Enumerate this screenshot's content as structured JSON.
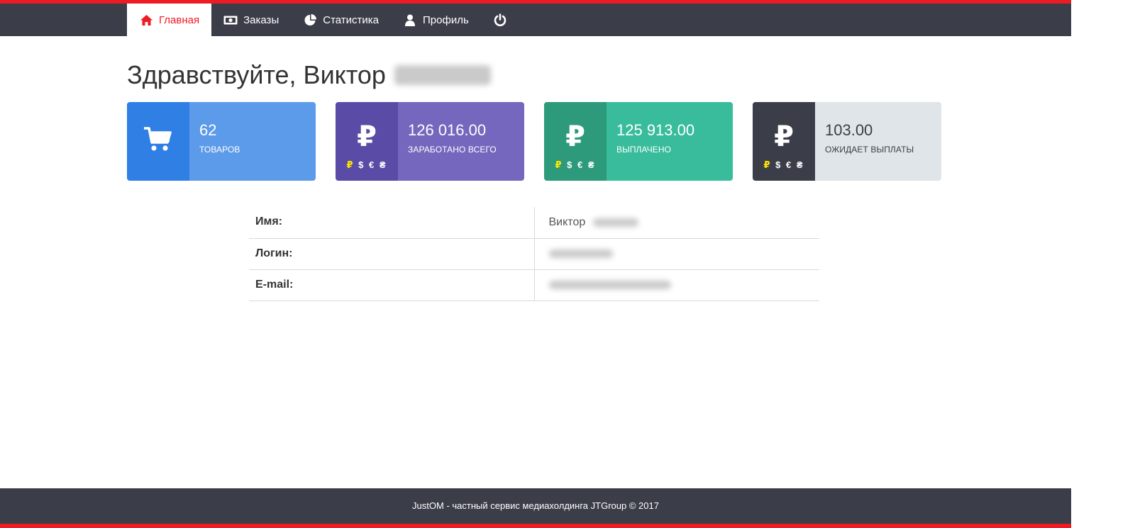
{
  "nav": {
    "items": [
      {
        "label": "Главная",
        "icon": "home-icon",
        "active": true
      },
      {
        "label": "Заказы",
        "icon": "money-icon",
        "active": false
      },
      {
        "label": "Статистика",
        "icon": "pie-chart-icon",
        "active": false
      },
      {
        "label": "Профиль",
        "icon": "user-icon",
        "active": false
      },
      {
        "label": "",
        "icon": "power-icon",
        "active": false
      }
    ]
  },
  "greeting": {
    "text": "Здравствуйте, Виктор"
  },
  "cards": [
    {
      "value": "62",
      "label": "ТОВАРОВ",
      "icon": "cart-icon",
      "currencies": ""
    },
    {
      "value": "126 016.00",
      "label": "ЗАРАБОТАНО ВСЕГО",
      "icon": "ruble-icon",
      "currencies": "₽ $ € ₴"
    },
    {
      "value": "125 913.00",
      "label": "ВЫПЛАЧЕНО",
      "icon": "ruble-icon",
      "currencies": "₽ $ € ₴"
    },
    {
      "value": "103.00",
      "label": "ОЖИДАЕТ ВЫПЛАТЫ",
      "icon": "ruble-icon",
      "currencies": "₽ $ € ₴"
    }
  ],
  "profile": {
    "rows": [
      {
        "key": "Имя:",
        "value": "Виктор"
      },
      {
        "key": "Логин:",
        "value": ""
      },
      {
        "key": "E-mail:",
        "value": ""
      }
    ]
  },
  "footer": {
    "text": "JustOM - частный сервис медиахолдинга JTGroup © 2017"
  },
  "colors": {
    "accent": "#ee1b22",
    "navbar": "#3b3e49",
    "card_blue": "#5c9aea",
    "card_purple": "#7567bd",
    "card_green": "#38bc9b",
    "card_gray": "#dfe5e8"
  }
}
